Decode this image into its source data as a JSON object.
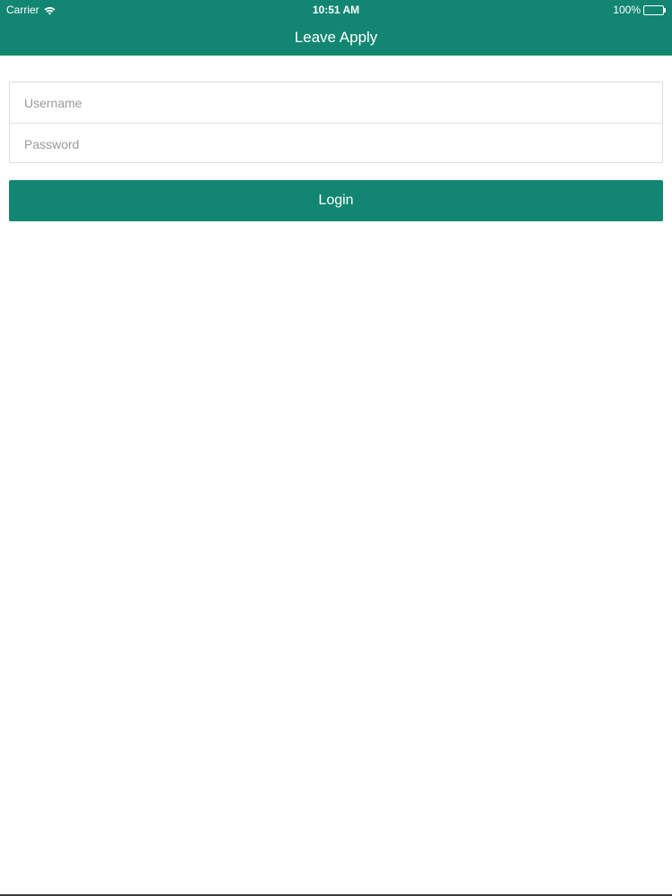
{
  "status_bar": {
    "carrier": "Carrier",
    "time": "10:51 AM",
    "battery": "100%",
    "icons": [
      "wifi-icon",
      "battery-icon"
    ]
  },
  "nav": {
    "title": "Leave Apply"
  },
  "login_form": {
    "username_placeholder": "Username",
    "username_value": "",
    "password_placeholder": "Password",
    "password_value": "",
    "login_label": "Login"
  },
  "colors": {
    "brand": "#128672",
    "background": "#ffffff",
    "field_border": "#dcdcdc",
    "placeholder": "#9a9a9a"
  }
}
